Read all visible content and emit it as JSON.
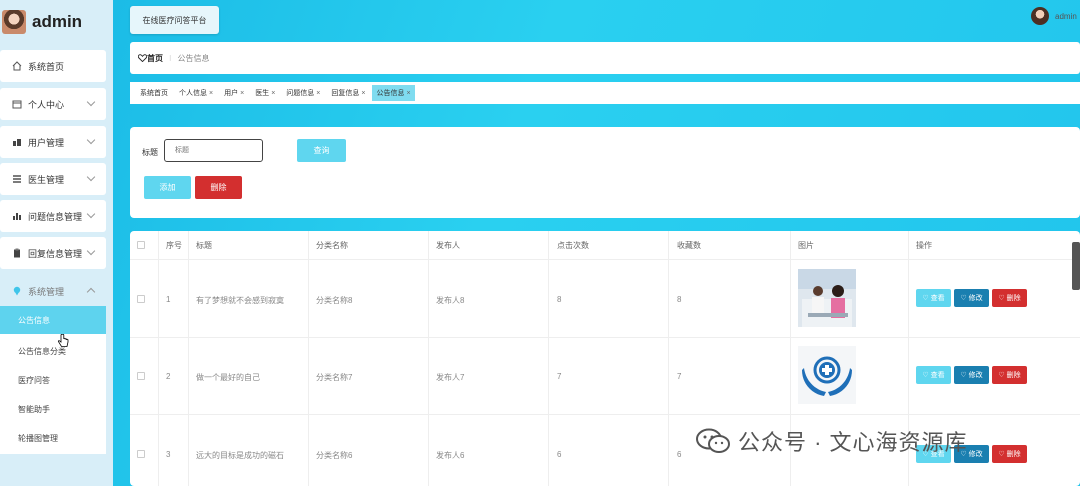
{
  "app": {
    "brand": "admin",
    "top_button": "在线医疗问答平台",
    "user_name": "admin"
  },
  "sidebar": {
    "items": [
      {
        "label": "系统首页",
        "icon": "home-icon"
      },
      {
        "label": "个人中心",
        "icon": "calendar-icon"
      },
      {
        "label": "用户管理",
        "icon": "chart-icon"
      },
      {
        "label": "医生管理",
        "icon": "list-icon"
      },
      {
        "label": "问题信息管理",
        "icon": "bar-chart-icon"
      },
      {
        "label": "回复信息管理",
        "icon": "clipboard-icon"
      },
      {
        "label": "系统管理",
        "icon": "location-pin-icon"
      }
    ],
    "submenu": [
      "公告信息",
      "公告信息分类",
      "医疗问答",
      "智能助手",
      "轮播图管理"
    ]
  },
  "breadcrumb": {
    "home": "首页",
    "current": "公告信息"
  },
  "tags": [
    {
      "label": "系统首页",
      "closable": false
    },
    {
      "label": "个人信息",
      "closable": true
    },
    {
      "label": "用户",
      "closable": true
    },
    {
      "label": "医生",
      "closable": true
    },
    {
      "label": "问题信息",
      "closable": true
    },
    {
      "label": "回复信息",
      "closable": true
    },
    {
      "label": "公告信息",
      "closable": true,
      "active": true
    }
  ],
  "search": {
    "label": "标题",
    "placeholder": "标题",
    "query_button": "查询",
    "add_button": "添加",
    "delete_button": "删除"
  },
  "table": {
    "columns": [
      "序号",
      "标题",
      "分类名称",
      "发布人",
      "点击次数",
      "收藏数",
      "图片",
      "操作"
    ],
    "rows": [
      {
        "no": "1",
        "title": "有了梦想就不会感到寂寞",
        "category": "分类名称8",
        "publisher": "发布人8",
        "clicks": "8",
        "favorites": "8",
        "image": "people-photo"
      },
      {
        "no": "2",
        "title": "做一个最好的自己",
        "category": "分类名称7",
        "publisher": "发布人7",
        "clicks": "7",
        "favorites": "7",
        "image": "medical-hands-logo"
      },
      {
        "no": "3",
        "title": "远大的目标是成功的磁石",
        "category": "分类名称6",
        "publisher": "发布人6",
        "clicks": "6",
        "favorites": "6",
        "image": ""
      }
    ],
    "actions": {
      "view": "查看",
      "edit": "修改",
      "delete": "删除"
    }
  },
  "watermark": "公众号 · 文心海资源库",
  "colors": {
    "accent": "#1fc4ec",
    "primary_light": "#5ed3ee",
    "danger": "#d32f2f",
    "edit_blue": "#1a7fb0"
  }
}
